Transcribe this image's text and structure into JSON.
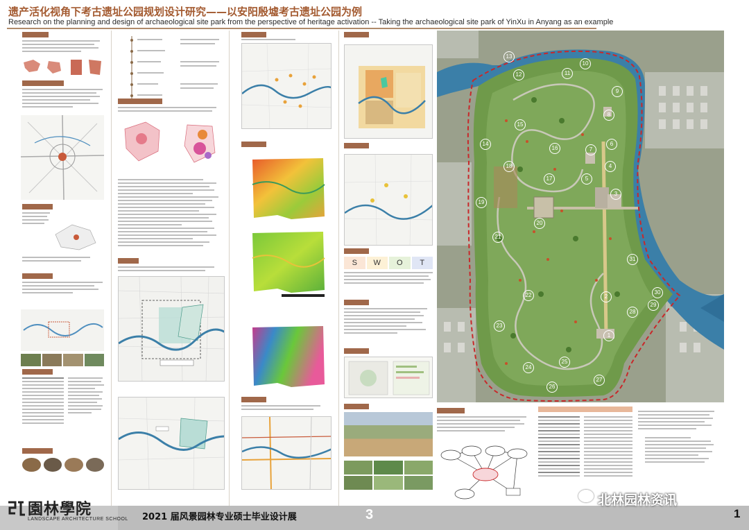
{
  "header": {
    "title_cn": "遗产活化视角下考古遗址公园规划设计研究——以安阳殷墟考古遗址公园为例",
    "title_en": "Research on the planning and design of archaeological site park from the perspective of heritage activation -- Taking the archaeological site park of YinXu in Anyang as an  example"
  },
  "swot": {
    "s": "S",
    "w": "W",
    "o": "O",
    "t": "T"
  },
  "masterplan": {
    "labels": [
      "13",
      "12",
      "11",
      "10",
      "9",
      "8",
      "15",
      "14",
      "6",
      "7",
      "4",
      "5",
      "3",
      "16",
      "17",
      "19",
      "18",
      "20",
      "21",
      "31",
      "30",
      "22",
      "2",
      "29",
      "28",
      "23",
      "1",
      "24",
      "25",
      "26",
      "27"
    ]
  },
  "footer": {
    "school_cn": "園林學院",
    "school_en": "LANDSCAPE ARCHITECTURE SCHOOL",
    "exhibition_title": "2021 届风景园林专业硕士毕业设计展",
    "section_number": "3",
    "page_number": "1"
  },
  "watermark": {
    "text": "北林园林资讯"
  },
  "colors": {
    "title_brown": "#a35a30",
    "section_tag": "#a0684a",
    "river_blue": "#3b7fa8",
    "site_boundary": "#c8282a"
  }
}
